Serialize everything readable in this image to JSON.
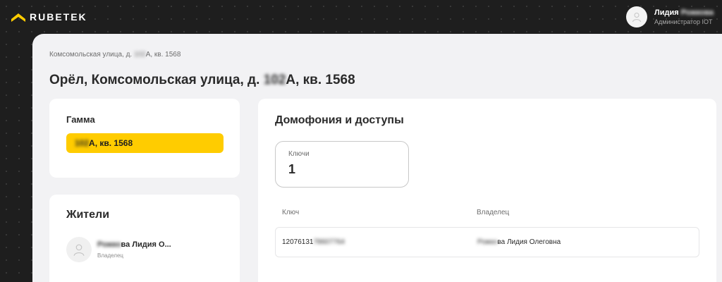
{
  "app": {
    "brand": "RUBETEK"
  },
  "user": {
    "first_name": "Лидия",
    "last_name_hidden": "Рожкова",
    "role": "Администратор IOT"
  },
  "breadcrumb": {
    "prefix": "Комсомольская улица, д. ",
    "hidden": "102",
    "suffix": "А, кв. 1568"
  },
  "title": {
    "prefix": "Орёл, Комсомольская улица, д. ",
    "hidden": "102",
    "suffix": "А, кв. 1568"
  },
  "complex": {
    "label": "Гамма",
    "apartment_hidden": "102",
    "apartment_suffix": "А, кв. 1568"
  },
  "residents": {
    "title": "Жители",
    "items": [
      {
        "name_hidden": "Рожко",
        "name_suffix": "ва Лидия О...",
        "role": "Владелец"
      }
    ]
  },
  "intercom": {
    "title": "Домофония и доступы",
    "keys_label": "Ключи",
    "keys_count": "1",
    "table": {
      "headers": {
        "key": "Ключ",
        "owner": "Владелец"
      },
      "rows": [
        {
          "key_prefix": "12076131",
          "key_hidden": "78607764",
          "owner_hidden": "Рожко",
          "owner_suffix": "ва Лидия Олеговна"
        }
      ]
    }
  },
  "colors": {
    "accent": "#ffcc00",
    "dark_bg": "#1e1e1e",
    "panel_bg": "#f2f2f4"
  }
}
